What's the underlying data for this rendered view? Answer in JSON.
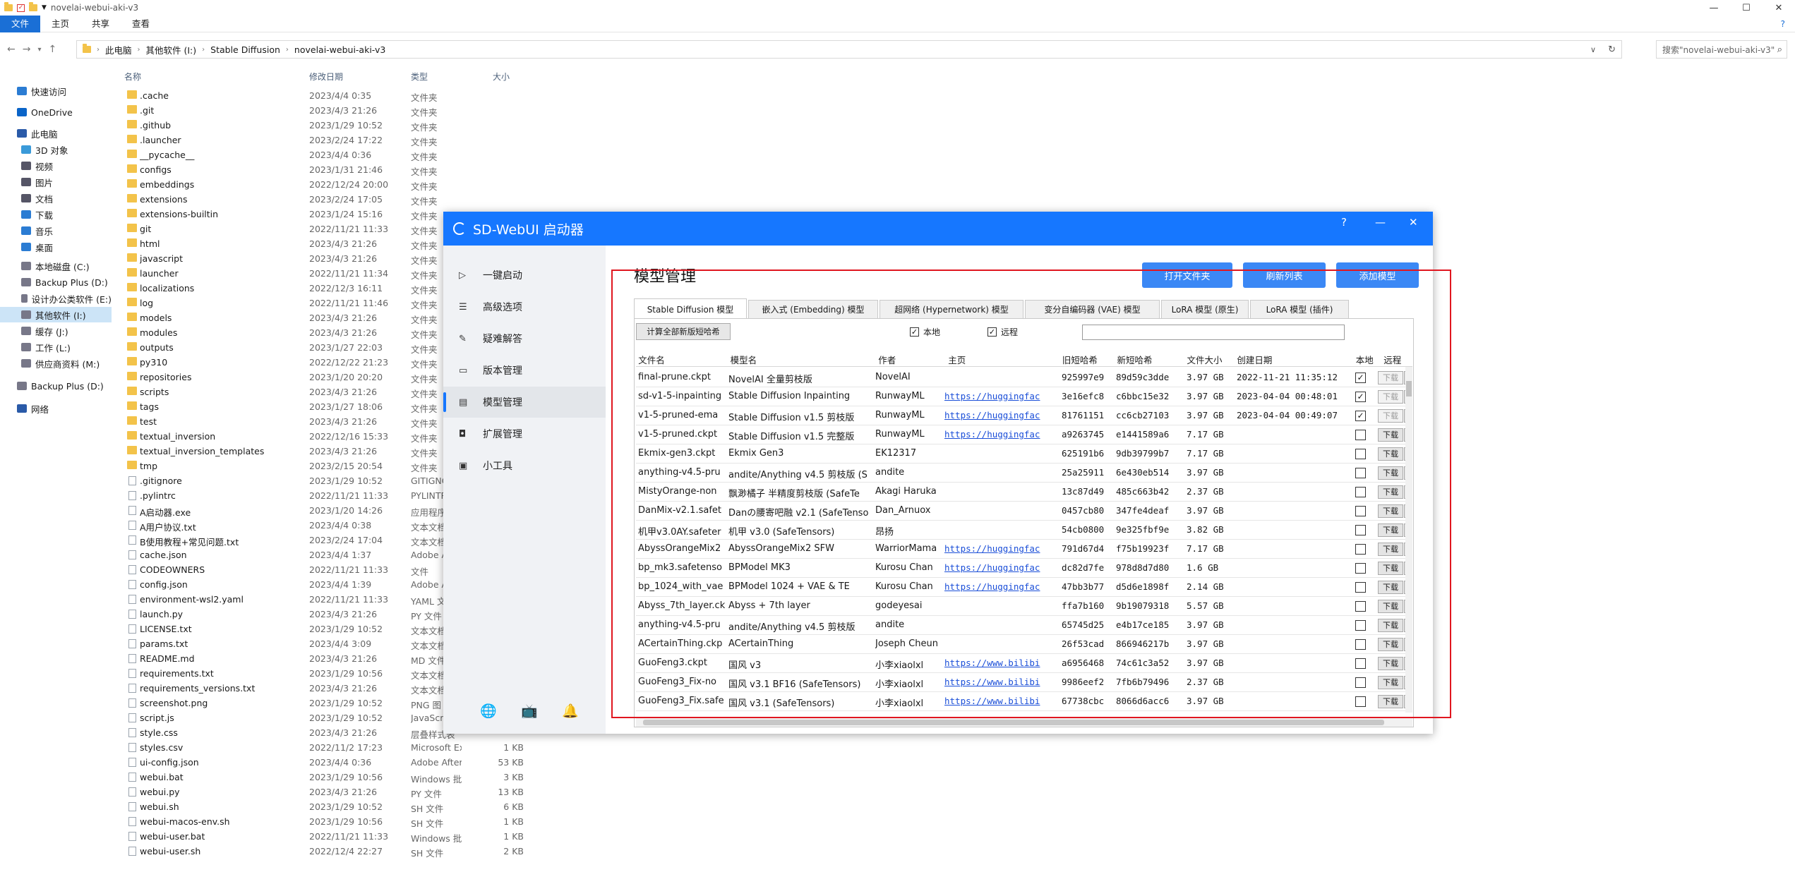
{
  "explorer": {
    "title": "novelai-webui-aki-v3",
    "ribbon_tabs": [
      "文件",
      "主页",
      "共享",
      "查看"
    ],
    "breadcrumbs": [
      "此电脑",
      "其他软件 (I:)",
      "Stable Diffusion",
      "novelai-webui-aki-v3"
    ],
    "search_placeholder": "搜索\"novelai-webui-aki-v3\"",
    "nav_items": [
      {
        "label": "快速访问",
        "icon": "star-icon",
        "color": "#2b7cd3"
      },
      {
        "label": "OneDrive",
        "icon": "cloud-icon",
        "color": "#0a64c8"
      },
      {
        "label": "此电脑",
        "icon": "pc-icon",
        "color": "#2a5aa8"
      },
      {
        "label": "3D 对象",
        "icon": "cube-icon",
        "color": "#3a9ad9"
      },
      {
        "label": "视频",
        "icon": "video-icon",
        "color": "#556"
      },
      {
        "label": "图片",
        "icon": "picture-icon",
        "color": "#556"
      },
      {
        "label": "文档",
        "icon": "document-icon",
        "color": "#556"
      },
      {
        "label": "下载",
        "icon": "download-icon",
        "color": "#2b7cd3"
      },
      {
        "label": "音乐",
        "icon": "music-icon",
        "color": "#2b7cd3"
      },
      {
        "label": "桌面",
        "icon": "desktop-icon",
        "color": "#2b7cd3"
      },
      {
        "label": "本地磁盘 (C:)",
        "icon": "drive-icon",
        "color": "#778"
      },
      {
        "label": "Backup Plus (D:)",
        "icon": "drive-icon",
        "color": "#778"
      },
      {
        "label": "设计办公类软件 (E:)",
        "icon": "drive-icon",
        "color": "#778"
      },
      {
        "label": "其他软件 (I:)",
        "icon": "drive-icon",
        "color": "#778"
      },
      {
        "label": "缓存 (J:)",
        "icon": "drive-icon",
        "color": "#778"
      },
      {
        "label": "工作 (L:)",
        "icon": "drive-icon",
        "color": "#778"
      },
      {
        "label": "供应商资料 (M:)",
        "icon": "drive-icon",
        "color": "#778"
      },
      {
        "label": "Backup Plus (D:)",
        "icon": "drive-icon",
        "color": "#778"
      },
      {
        "label": "网络",
        "icon": "network-icon",
        "color": "#2a5aa8"
      }
    ],
    "columns": {
      "name": "名称",
      "date": "修改日期",
      "type": "类型",
      "size": "大小"
    },
    "files": [
      {
        "name": ".cache",
        "date": "2023/4/4 0:35",
        "type": "文件夹",
        "size": "",
        "kind": "folder"
      },
      {
        "name": ".git",
        "date": "2023/4/3 21:26",
        "type": "文件夹",
        "size": "",
        "kind": "folder"
      },
      {
        "name": ".github",
        "date": "2023/1/29 10:52",
        "type": "文件夹",
        "size": "",
        "kind": "folder"
      },
      {
        "name": ".launcher",
        "date": "2023/2/24 17:22",
        "type": "文件夹",
        "size": "",
        "kind": "folder"
      },
      {
        "name": "__pycache__",
        "date": "2023/4/4 0:36",
        "type": "文件夹",
        "size": "",
        "kind": "folder"
      },
      {
        "name": "configs",
        "date": "2023/1/31 21:46",
        "type": "文件夹",
        "size": "",
        "kind": "folder"
      },
      {
        "name": "embeddings",
        "date": "2022/12/24 20:00",
        "type": "文件夹",
        "size": "",
        "kind": "folder"
      },
      {
        "name": "extensions",
        "date": "2023/2/24 17:05",
        "type": "文件夹",
        "size": "",
        "kind": "folder"
      },
      {
        "name": "extensions-builtin",
        "date": "2023/1/24 15:16",
        "type": "文件夹",
        "size": "",
        "kind": "folder"
      },
      {
        "name": "git",
        "date": "2022/11/21 11:33",
        "type": "文件夹",
        "size": "",
        "kind": "folder"
      },
      {
        "name": "html",
        "date": "2023/4/3 21:26",
        "type": "文件夹",
        "size": "",
        "kind": "folder"
      },
      {
        "name": "javascript",
        "date": "2023/4/3 21:26",
        "type": "文件夹",
        "size": "",
        "kind": "folder"
      },
      {
        "name": "launcher",
        "date": "2022/11/21 11:34",
        "type": "文件夹",
        "size": "",
        "kind": "folder"
      },
      {
        "name": "localizations",
        "date": "2022/12/3 16:11",
        "type": "文件夹",
        "size": "",
        "kind": "folder"
      },
      {
        "name": "log",
        "date": "2022/11/21 11:46",
        "type": "文件夹",
        "size": "",
        "kind": "folder"
      },
      {
        "name": "models",
        "date": "2023/4/3 21:26",
        "type": "文件夹",
        "size": "",
        "kind": "folder"
      },
      {
        "name": "modules",
        "date": "2023/4/3 21:26",
        "type": "文件夹",
        "size": "",
        "kind": "folder"
      },
      {
        "name": "outputs",
        "date": "2023/1/27 22:03",
        "type": "文件夹",
        "size": "",
        "kind": "folder"
      },
      {
        "name": "py310",
        "date": "2022/12/22 21:23",
        "type": "文件夹",
        "size": "",
        "kind": "folder"
      },
      {
        "name": "repositories",
        "date": "2023/1/20 20:20",
        "type": "文件夹",
        "size": "",
        "kind": "folder"
      },
      {
        "name": "scripts",
        "date": "2023/4/3 21:26",
        "type": "文件夹",
        "size": "",
        "kind": "folder"
      },
      {
        "name": "tags",
        "date": "2023/1/27 18:06",
        "type": "文件夹",
        "size": "",
        "kind": "folder"
      },
      {
        "name": "test",
        "date": "2023/4/3 21:26",
        "type": "文件夹",
        "size": "",
        "kind": "folder"
      },
      {
        "name": "textual_inversion",
        "date": "2022/12/16 15:33",
        "type": "文件夹",
        "size": "",
        "kind": "folder"
      },
      {
        "name": "textual_inversion_templates",
        "date": "2023/4/3 21:26",
        "type": "文件夹",
        "size": "",
        "kind": "folder"
      },
      {
        "name": "tmp",
        "date": "2023/2/15 20:54",
        "type": "文件夹",
        "size": "",
        "kind": "folder"
      },
      {
        "name": ".gitignore",
        "date": "2023/1/29 10:52",
        "type": "GITIGNO",
        "size": "",
        "kind": "file"
      },
      {
        "name": ".pylintrc",
        "date": "2022/11/21 11:33",
        "type": "PYLINTR",
        "size": "",
        "kind": "file"
      },
      {
        "name": "A启动器.exe",
        "date": "2023/1/20 14:26",
        "type": "应用程序",
        "size": "",
        "kind": "file"
      },
      {
        "name": "A用户协议.txt",
        "date": "2023/4/4 0:38",
        "type": "文本文档",
        "size": "",
        "kind": "file"
      },
      {
        "name": "B使用教程+常见问题.txt",
        "date": "2023/2/24 17:04",
        "type": "文本文档",
        "size": "",
        "kind": "file"
      },
      {
        "name": "cache.json",
        "date": "2023/4/4 1:37",
        "type": "Adobe A",
        "size": "",
        "kind": "file"
      },
      {
        "name": "CODEOWNERS",
        "date": "2022/11/21 11:33",
        "type": "文件",
        "size": "",
        "kind": "file"
      },
      {
        "name": "config.json",
        "date": "2023/4/4 1:39",
        "type": "Adobe A",
        "size": "",
        "kind": "file"
      },
      {
        "name": "environment-wsl2.yaml",
        "date": "2022/11/21 11:33",
        "type": "YAML 文",
        "size": "",
        "kind": "file"
      },
      {
        "name": "launch.py",
        "date": "2023/4/3 21:26",
        "type": "PY 文件",
        "size": "",
        "kind": "file"
      },
      {
        "name": "LICENSE.txt",
        "date": "2023/1/29 10:52",
        "type": "文本文档",
        "size": "",
        "kind": "file"
      },
      {
        "name": "params.txt",
        "date": "2023/4/4 3:09",
        "type": "文本文档",
        "size": "",
        "kind": "file"
      },
      {
        "name": "README.md",
        "date": "2023/4/3 21:26",
        "type": "MD 文件",
        "size": "",
        "kind": "file"
      },
      {
        "name": "requirements.txt",
        "date": "2023/1/29 10:56",
        "type": "文本文档",
        "size": "",
        "kind": "file"
      },
      {
        "name": "requirements_versions.txt",
        "date": "2023/4/3 21:26",
        "type": "文本文档",
        "size": "",
        "kind": "file"
      },
      {
        "name": "screenshot.png",
        "date": "2023/1/29 10:52",
        "type": "PNG 图",
        "size": "",
        "kind": "file"
      },
      {
        "name": "script.js",
        "date": "2023/1/29 10:52",
        "type": "JavaScr",
        "size": "",
        "kind": "file"
      },
      {
        "name": "style.css",
        "date": "2023/4/3 21:26",
        "type": "层叠样式表",
        "size": "",
        "kind": "file"
      },
      {
        "name": "styles.csv",
        "date": "2022/11/2 17:23",
        "type": "Microsoft Excel ...",
        "size": "1 KB",
        "kind": "file"
      },
      {
        "name": "ui-config.json",
        "date": "2023/4/4 0:36",
        "type": "Adobe After Effe...",
        "size": "53 KB",
        "kind": "file"
      },
      {
        "name": "webui.bat",
        "date": "2023/1/29 10:56",
        "type": "Windows 批处理...",
        "size": "3 KB",
        "kind": "file"
      },
      {
        "name": "webui.py",
        "date": "2023/4/3 21:26",
        "type": "PY 文件",
        "size": "13 KB",
        "kind": "file"
      },
      {
        "name": "webui.sh",
        "date": "2023/1/29 10:52",
        "type": "SH 文件",
        "size": "6 KB",
        "kind": "file"
      },
      {
        "name": "webui-macos-env.sh",
        "date": "2023/1/29 10:56",
        "type": "SH 文件",
        "size": "1 KB",
        "kind": "file"
      },
      {
        "name": "webui-user.bat",
        "date": "2022/11/21 11:33",
        "type": "Windows 批处理...",
        "size": "1 KB",
        "kind": "file"
      },
      {
        "name": "webui-user.sh",
        "date": "2022/12/4 22:27",
        "type": "SH 文件",
        "size": "2 KB",
        "kind": "file"
      }
    ]
  },
  "launcher": {
    "title": "SD-WebUI 启动器",
    "title_controls": [
      "?",
      "—",
      "✕"
    ],
    "sidebar": [
      {
        "label": "一键启动",
        "icon": "play-icon",
        "glyph": "▷"
      },
      {
        "label": "高级选项",
        "icon": "list-icon",
        "glyph": "☰"
      },
      {
        "label": "疑难解答",
        "icon": "wrench-icon",
        "glyph": "✎"
      },
      {
        "label": "版本管理",
        "icon": "version-icon",
        "glyph": "▭"
      },
      {
        "label": "模型管理",
        "icon": "box-icon",
        "glyph": "▤"
      },
      {
        "label": "扩展管理",
        "icon": "extension-icon",
        "glyph": "◘"
      },
      {
        "label": "小工具",
        "icon": "toolbox-icon",
        "glyph": "▣"
      }
    ],
    "active_index": 4,
    "bottom_icons": [
      {
        "icon": "globe-icon",
        "glyph": "🌐"
      },
      {
        "icon": "bilibili-icon",
        "glyph": "📺"
      },
      {
        "icon": "qq-icon",
        "glyph": "🔔"
      }
    ],
    "page_title": "模型管理",
    "buttons": {
      "open_folder": "打开文件夹",
      "refresh": "刷新列表",
      "add_model": "添加模型"
    },
    "tabs": [
      "Stable Diffusion 模型",
      "嵌入式 (Embedding) 模型",
      "超网络 (Hypernetwork) 模型",
      "变分自编码器 (VAE) 模型",
      "LoRA 模型 (原生)",
      "LoRA 模型 (插件)"
    ],
    "calc_button": "计算全部新版短哈希",
    "filter_local": "本地",
    "filter_remote": "远程",
    "table_columns": [
      "文件名",
      "模型名",
      "作者",
      "主页",
      "旧短哈希",
      "新短哈希",
      "文件大小",
      "创建日期",
      "本地",
      "远程",
      ""
    ],
    "download_label": "下载",
    "rows": [
      {
        "file": "final-prune.ckpt",
        "model": "NovelAI 全量剪枝版",
        "author": "NovelAI",
        "home": "",
        "old": "925997e9",
        "new": "89d59c3dde",
        "size": "3.97 GB",
        "date": "2022-11-21 11:35:12",
        "local": true,
        "remote": false,
        "dl_disabled": true
      },
      {
        "file": "sd-v1-5-inpainting",
        "model": "Stable Diffusion Inpainting",
        "author": "RunwayML",
        "home": "https://huggingfac",
        "old": "3e16efc8",
        "new": "c6bbc15e32",
        "size": "3.97 GB",
        "date": "2023-04-04 00:48:01",
        "local": true,
        "remote": true,
        "dl_disabled": true
      },
      {
        "file": "v1-5-pruned-ema",
        "model": "Stable Diffusion v1.5 剪枝版",
        "author": "RunwayML",
        "home": "https://huggingfac",
        "old": "81761151",
        "new": "cc6cb27103",
        "size": "3.97 GB",
        "date": "2023-04-04 00:49:07",
        "local": true,
        "remote": true,
        "dl_disabled": true
      },
      {
        "file": "v1-5-pruned.ckpt",
        "model": "Stable Diffusion v1.5 完整版",
        "author": "RunwayML",
        "home": "https://huggingfac",
        "old": "a9263745",
        "new": "e1441589a6",
        "size": "7.17 GB",
        "date": "",
        "local": false,
        "remote": true,
        "dl_disabled": false
      },
      {
        "file": "Ekmix-gen3.ckpt",
        "model": "Ekmix Gen3",
        "author": "EK12317",
        "home": "",
        "old": "625191b6",
        "new": "9db39799b7",
        "size": "7.17 GB",
        "date": "",
        "local": false,
        "remote": true,
        "dl_disabled": false
      },
      {
        "file": "anything-v4.5-pru",
        "model": "andite/Anything v4.5 剪枝版 (S",
        "author": "andite",
        "home": "",
        "old": "25a25911",
        "new": "6e430eb514",
        "size": "3.97 GB",
        "date": "",
        "local": false,
        "remote": true,
        "dl_disabled": false
      },
      {
        "file": "MistyOrange-non",
        "model": "飘渺橘子 半精度剪枝版 (SafeTe",
        "author": "Akagi Haruka",
        "home": "",
        "old": "13c87d49",
        "new": "485c663b42",
        "size": "2.37 GB",
        "date": "",
        "local": false,
        "remote": true,
        "dl_disabled": false
      },
      {
        "file": "DanMix-v2.1.safet",
        "model": "Danの腰寄吧融 v2.1 (SafeTenso",
        "author": "Dan_Arnuox",
        "home": "",
        "old": "0457cb80",
        "new": "347fe4deaf",
        "size": "3.97 GB",
        "date": "",
        "local": false,
        "remote": true,
        "dl_disabled": false
      },
      {
        "file": "机甲v3.0AY.safeter",
        "model": "机甲 v3.0 (SafeTensors)",
        "author": "昂扬",
        "home": "",
        "old": "54cb0800",
        "new": "9e325fbf9e",
        "size": "3.82 GB",
        "date": "",
        "local": false,
        "remote": true,
        "dl_disabled": false
      },
      {
        "file": "AbyssOrangeMix2",
        "model": "AbyssOrangeMix2 SFW",
        "author": "WarriorMama",
        "home": "https://huggingfac",
        "old": "791d67d4",
        "new": "f75b19923f",
        "size": "7.17 GB",
        "date": "",
        "local": false,
        "remote": true,
        "dl_disabled": false
      },
      {
        "file": "bp_mk3.safetenso",
        "model": "BPModel MK3",
        "author": "Kurosu Chan",
        "home": "https://huggingfac",
        "old": "dc82d7fe",
        "new": "978d8d7d80",
        "size": "1.6 GB",
        "date": "",
        "local": false,
        "remote": true,
        "dl_disabled": false
      },
      {
        "file": "bp_1024_with_vae",
        "model": "BPModel 1024 + VAE & TE",
        "author": "Kurosu Chan",
        "home": "https://huggingfac",
        "old": "47bb3b77",
        "new": "d5d6e1898f",
        "size": "2.14 GB",
        "date": "",
        "local": false,
        "remote": true,
        "dl_disabled": false
      },
      {
        "file": "Abyss_7th_layer.ck",
        "model": "Abyss + 7th layer",
        "author": "godeyesai",
        "home": "",
        "old": "ffa7b160",
        "new": "9b19079318",
        "size": "5.57 GB",
        "date": "",
        "local": false,
        "remote": true,
        "dl_disabled": false
      },
      {
        "file": "anything-v4.5-pru",
        "model": "andite/Anything v4.5 剪枝版",
        "author": "andite",
        "home": "",
        "old": "65745d25",
        "new": "e4b17ce185",
        "size": "3.97 GB",
        "date": "",
        "local": false,
        "remote": true,
        "dl_disabled": false
      },
      {
        "file": "ACertainThing.ckp",
        "model": "ACertainThing",
        "author": "Joseph Cheun",
        "home": "",
        "old": "26f53cad",
        "new": "866946217b",
        "size": "3.97 GB",
        "date": "",
        "local": false,
        "remote": true,
        "dl_disabled": false
      },
      {
        "file": "GuoFeng3.ckpt",
        "model": "国风 v3",
        "author": "小李xiaolxl",
        "home": "https://www.bilibi",
        "old": "a6956468",
        "new": "74c61c3a52",
        "size": "3.97 GB",
        "date": "",
        "local": false,
        "remote": true,
        "dl_disabled": false
      },
      {
        "file": "GuoFeng3_Fix-no",
        "model": "国风 v3.1 BF16 (SafeTensors)",
        "author": "小李xiaolxl",
        "home": "https://www.bilibi",
        "old": "9986eef2",
        "new": "7fb6b79496",
        "size": "2.37 GB",
        "date": "",
        "local": false,
        "remote": true,
        "dl_disabled": false
      },
      {
        "file": "GuoFeng3_Fix.safe",
        "model": "国风 v3.1 (SafeTensors)",
        "author": "小李xiaolxl",
        "home": "https://www.bilibi",
        "old": "67738cbc",
        "new": "8066d6acc6",
        "size": "3.97 GB",
        "date": "",
        "local": false,
        "remote": true,
        "dl_disabled": false
      }
    ]
  }
}
